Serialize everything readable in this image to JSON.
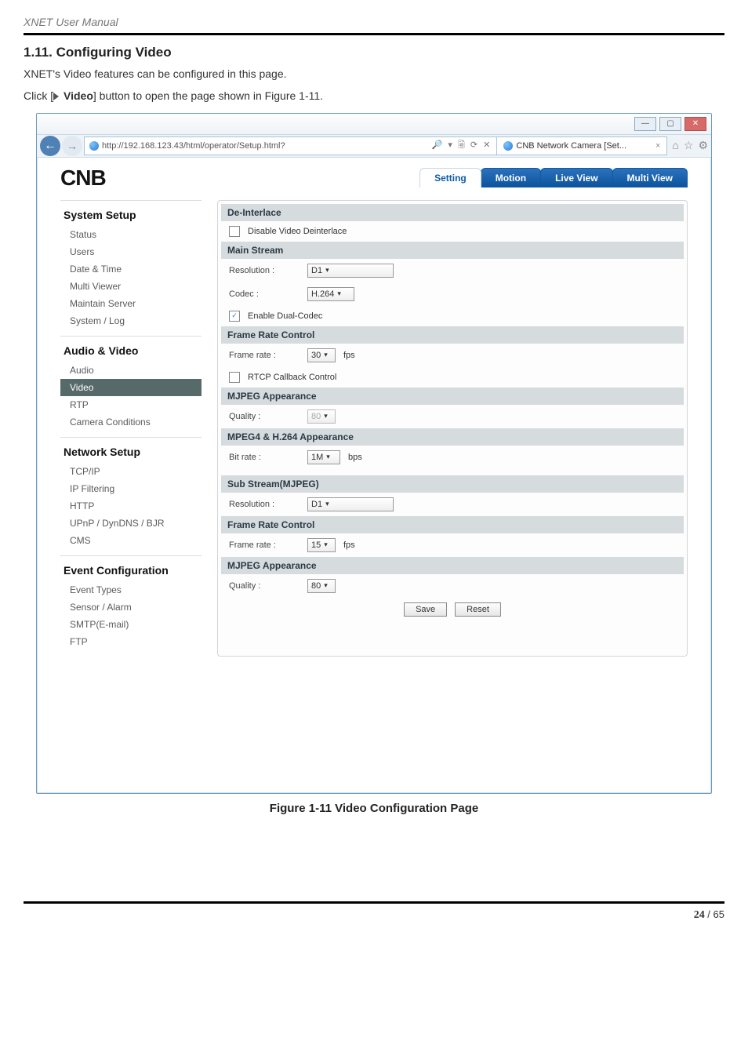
{
  "doc": {
    "headerTitle": "XNET User Manual",
    "sectionNumber": "1.11. Configuring Video",
    "descLine1": "XNET's Video features can be configured in this page.",
    "descLine2a": "Click [",
    "descLine2b": "Video",
    "descLine2c": "] button to open the page shown in Figure 1-11.",
    "figureCaption": "Figure 1-11 Video Configuration Page",
    "pageCurrent": "24",
    "pageSep": " / ",
    "pageTotal": "65"
  },
  "browser": {
    "url": "http://192.168.123.43/html/operator/Setup.html?",
    "urlTools": "🔎 ▾ 🗟 ⟳ ✕",
    "tabTitle": "CNB Network Camera [Set...",
    "tabClose": "×",
    "winMin": "—",
    "winMax": "▢",
    "winClose": "✕",
    "toolIcons": [
      "⌂",
      "☆",
      "⚙"
    ]
  },
  "topnav": {
    "logo": "CNB",
    "tabs": {
      "setting": "Setting",
      "motion": "Motion",
      "liveView": "Live View",
      "multiView": "Multi View"
    }
  },
  "sidebar": {
    "systemSetup": {
      "title": "System Setup",
      "items": [
        "Status",
        "Users",
        "Date & Time",
        "Multi Viewer",
        "Maintain Server",
        "System / Log"
      ]
    },
    "audioVideo": {
      "title": "Audio & Video",
      "items": [
        "Audio",
        "Video",
        "RTP",
        "Camera Conditions"
      ]
    },
    "networkSetup": {
      "title": "Network Setup",
      "items": [
        "TCP/IP",
        "IP Filtering",
        "HTTP",
        "UPnP / DynDNS / BJR",
        "CMS"
      ]
    },
    "eventConfig": {
      "title": "Event Configuration",
      "items": [
        "Event Types",
        "Sensor / Alarm",
        "SMTP(E-mail)",
        "FTP"
      ]
    }
  },
  "panel": {
    "deinterlace": {
      "header": "De-Interlace",
      "checkboxLabel": "Disable Video Deinterlace"
    },
    "mainStream": {
      "header": "Main Stream",
      "resolutionLabel": "Resolution :",
      "resolutionValue": "D1",
      "codecLabel": "Codec :",
      "codecValue": "H.264",
      "enableDualCodec": "Enable Dual-Codec",
      "frameRateControl": "Frame Rate Control",
      "frameRateLabel": "Frame rate :",
      "frameRateValue": "30",
      "fpsUnit": "fps",
      "rtcpLabel": "RTCP Callback Control",
      "mjpegAppearance": "MJPEG Appearance",
      "qualityLabel": "Quality :",
      "qualityValue": "80",
      "mpegAppearance": "MPEG4 & H.264 Appearance",
      "bitrateLabel": "Bit rate :",
      "bitrateValue": "1M",
      "bpsUnit": "bps"
    },
    "subStream": {
      "header": "Sub Stream(MJPEG)",
      "resolutionLabel": "Resolution :",
      "resolutionValue": "D1",
      "frameRateControl": "Frame Rate Control",
      "frameRateLabel": "Frame rate :",
      "frameRateValue": "15",
      "fpsUnit": "fps",
      "mjpegAppearance": "MJPEG Appearance",
      "qualityLabel": "Quality :",
      "qualityValue": "80"
    },
    "buttons": {
      "save": "Save",
      "reset": "Reset"
    }
  }
}
